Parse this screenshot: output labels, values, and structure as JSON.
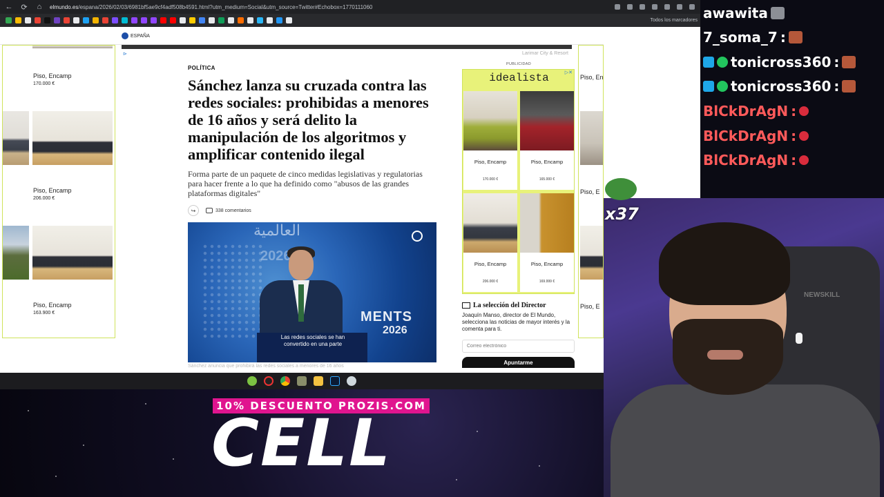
{
  "browser": {
    "url_domain": "elmundo.es",
    "url_rest": "/espana/2026/02/03/6981bf5ae9cf4adf508b4591.html?utm_medium=Social&utm_source=Twitter#Echobox=1770111060",
    "bookmarks_label": "Todos los marcadores",
    "nav": {
      "back": "←",
      "forward": "→",
      "reload": "⟳",
      "home": "⌂"
    }
  },
  "site": {
    "section": "ESPAÑA"
  },
  "left_ad": {
    "items": [
      {
        "label": "Piso, Encamp",
        "price": "170.000 €"
      },
      {
        "label": "Piso, Encamp",
        "price": "206.000 €"
      },
      {
        "label": "Piso, Encamp",
        "price": "163.900 €"
      }
    ]
  },
  "right_side_ad": {
    "items": [
      {
        "label": "Piso, Encamp"
      },
      {
        "label": "Piso, E"
      },
      {
        "label": "Piso, E"
      }
    ]
  },
  "article": {
    "kicker": "POLÍTICA",
    "headline": "Sánchez lanza su cruzada contra las redes sociales: prohibidas a menores de 16 años y será delito la manipulación de los algoritmos y amplificar contenido ilegal",
    "dek": "Forma parte de un paquete de cinco medidas legislativas y regulatorias para hacer frente a lo que ha definido como \"abusos de las grandes plataformas digitales\"",
    "comments": "338 comentarios",
    "photo_caption": "Las redes sociales se han convertido en una parte",
    "photo_bg_arabic": "العالمية",
    "photo_bg_year": "2026",
    "photo_bg_ments": "MENTS",
    "photo_bg_year2": "2026",
    "below_caption": "Sánchez anuncia que prohibirá las redes sociales a menores de 16 años"
  },
  "rail": {
    "top_ad": "Larimar City & Resort",
    "publicidad": "PUBLICIDAD",
    "idealista_brand": "idealista",
    "idealista_items": [
      {
        "label": "Piso, Encamp",
        "price": "170.000 €"
      },
      {
        "label": "Piso, Encamp",
        "price": "165.000 €"
      },
      {
        "label": "Piso, Encamp",
        "price": "206.000 €"
      },
      {
        "label": "Piso, Encamp",
        "price": "169.999 €"
      }
    ],
    "director_title": "La selección del Director",
    "director_text": "Joaquín Manso, director de El Mundo, selecciona las noticias de mayor interés y la comenta para ti.",
    "email_placeholder": "Correo electrónico",
    "subscribe_label": "Apuntarme"
  },
  "promo": {
    "band": "10% DESCUENTO PROZIS.COM",
    "big": "CELL"
  },
  "chat": [
    {
      "user": "awawita",
      "suffix": "",
      "color": "#ffffff"
    },
    {
      "user": "7_soma_7",
      "suffix": " :",
      "color": "#ffffff"
    },
    {
      "user": "tonicross360",
      "suffix": " :",
      "color": "#ffffff"
    },
    {
      "user": "tonicross360",
      "suffix": " :",
      "color": "#ffffff"
    },
    {
      "user": "BlCkDrAgN",
      "suffix": " :",
      "color": "#ff5a5a"
    },
    {
      "user": "BlCkDrAgN",
      "suffix": " :",
      "color": "#ff5a5a"
    },
    {
      "user": "BlCkDrAgN",
      "suffix": " :",
      "color": "#ff5a5a"
    }
  ],
  "overlay": {
    "emote_count": "x37"
  },
  "cam": {
    "chair_brand": "NEWSKILL"
  }
}
